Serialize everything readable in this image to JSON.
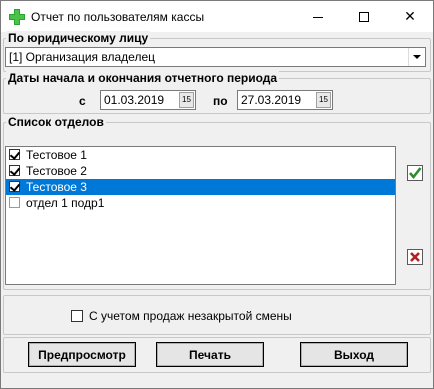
{
  "window": {
    "title": "Отчет по пользователям кассы",
    "minimize_symbol": "—",
    "maximize_symbol": "☐",
    "close_symbol": "✕"
  },
  "legal_entity": {
    "legend": "По юридическому лицу",
    "value": "[1] Организация владелец"
  },
  "period": {
    "legend": "Даты начала и окончания отчетного периода",
    "from_label": "с",
    "from_value": "01.03.2019",
    "to_label": "по",
    "to_value": "27.03.2019",
    "calendar_icon_text": "15"
  },
  "departments": {
    "legend": "Список отделов",
    "items": [
      {
        "label": "Тестовое 1",
        "checked": true,
        "selected": false
      },
      {
        "label": "Тестовое 2",
        "checked": true,
        "selected": false
      },
      {
        "label": "Тестовое 3",
        "checked": true,
        "selected": true
      },
      {
        "label": "отдел 1 подр1",
        "checked": false,
        "selected": false
      }
    ]
  },
  "options": {
    "unclosed_shift_label": "С учетом продаж незакрытой смены",
    "unclosed_shift_checked": false
  },
  "buttons": {
    "preview": "Предпросмотр",
    "print": "Печать",
    "exit": "Выход"
  },
  "colors": {
    "selection": "#0078d7",
    "check_all_icon": "#2e8b2e",
    "uncheck_all_icon": "#b22222"
  }
}
